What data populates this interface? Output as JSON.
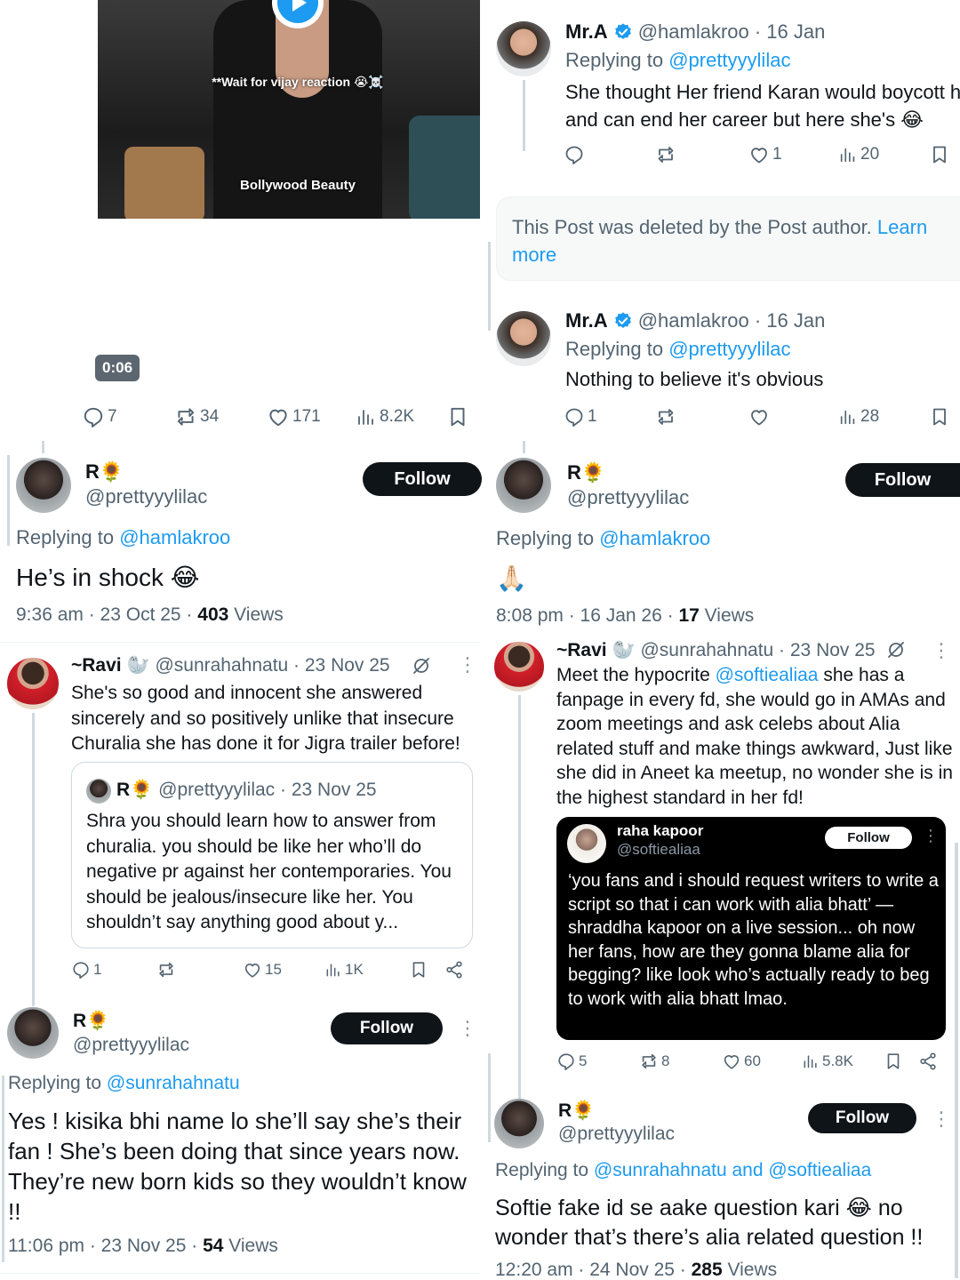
{
  "colors": {
    "accent": "#1d9bf0",
    "text": "#0f1419",
    "muted": "#536471",
    "dark_card": "#000000"
  },
  "left": {
    "video": {
      "overlay_text": "**Wait for vijay reaction 😭☠️",
      "caption": "Bollywood Beauty",
      "duration": "0:06",
      "play_icon": "play-icon"
    },
    "video_actions": {
      "replies": "7",
      "reposts": "34",
      "likes": "171",
      "views": "8.2K"
    },
    "reply1": {
      "name": "R🌻",
      "handle": "@prettyyylilac",
      "follow": "Follow",
      "replying_prefix": "Replying to ",
      "replying_to": "@hamlakroo",
      "text": "He’s in shock 😂",
      "time": "9:36 am · 23 Oct 25 · ",
      "views_count": "403",
      "views_label": " Views"
    },
    "ravi": {
      "name": "~Ravi 🦭",
      "handle": "@sunrahahnatu",
      "date": " · 23 Nov 25",
      "text": "She's so good and innocent she answered sincerely and so positively unlike that insecure Churalia she has done it for Jigra trailer before!",
      "quote": {
        "name": "R🌻",
        "handle": "@prettyyylilac",
        "date": " · 23 Nov 25",
        "text": "Shra you should learn how to answer from churalia. you should be like her who’ll do negative pr against her contemporaries. You should be jealous/insecure like her. You shouldn’t say anything good about y..."
      },
      "actions": {
        "replies": "1",
        "reposts": "",
        "likes": "15",
        "views": "1K"
      }
    },
    "reply2": {
      "name": "R🌻",
      "handle": "@prettyyylilac",
      "follow": "Follow",
      "replying_prefix": "Replying to ",
      "replying_to": "@sunrahahnatu",
      "text": "Yes ! kisika bhi name lo she’ll say she’s their fan ! She’s been doing that since years now. They’re new born kids so they wouldn’t know !!",
      "time": "11:06 pm · 23 Nov 25 · ",
      "views_count": "54",
      "views_label": " Views"
    }
  },
  "right": {
    "mra1": {
      "name": "Mr.A",
      "handle": "@hamlakroo",
      "date": " · 16 Jan",
      "replying_prefix": "Replying to ",
      "replying_to": "@prettyyylilac",
      "text": "She thought Her friend Karan would boycott her and can end her career but here she's 😂",
      "actions": {
        "replies": "",
        "reposts": "",
        "likes": "1",
        "views": "20"
      }
    },
    "deleted": {
      "text": "This Post was deleted by the Post author. ",
      "link": "Learn more"
    },
    "mra2": {
      "name": "Mr.A",
      "handle": "@hamlakroo",
      "date": " · 16 Jan",
      "replying_prefix": "Replying to ",
      "replying_to": "@prettyyylilac",
      "text": "Nothing to believe it's obvious",
      "actions": {
        "replies": "1",
        "reposts": "",
        "likes": "",
        "views": "28"
      }
    },
    "reply3": {
      "name": "R🌻",
      "handle": "@prettyyylilac",
      "follow": "Follow",
      "replying_prefix": "Replying to ",
      "replying_to": "@hamlakroo",
      "text": "🙏🏻",
      "time": "8:08 pm · 16 Jan 26 · ",
      "views_count": "17",
      "views_label": " Views"
    },
    "ravi": {
      "name": "~Ravi 🦭",
      "handle": "@sunrahahnatu",
      "date": " · 23 Nov 25",
      "text_pre": "Meet the hypocrite ",
      "mention": "@softiealiaa",
      "text_post": " she has a fanpage in every fd, she would go in AMAs and zoom meetings and ask celebs about Alia related stuff and make things awkward, Just like she did in Aneet ka meetup, no wonder she is in the highest standard in her fd!",
      "card": {
        "name": "raha kapoor",
        "handle": "@softiealiaa",
        "follow": "Follow",
        "text": "‘you fans and i should request writers to write a script so that i can work with alia bhatt’ — shraddha kapoor on a live session... oh now her fans, how are they gonna blame alia for begging? like look who’s actually ready to beg to work with alia bhatt lmao."
      },
      "actions": {
        "replies": "5",
        "reposts": "8",
        "likes": "60",
        "views": "5.8K"
      }
    },
    "reply4": {
      "name": "R🌻",
      "handle": "@prettyyylilac",
      "follow": "Follow",
      "replying_prefix": "Replying to ",
      "replying_to": "@sunrahahnatu and @softiealiaa",
      "text": "Softie fake id se aake question kari 😂 no wonder that’s there’s alia related question !!",
      "time": "12:20 am · 24 Nov 25 · ",
      "views_count": "285",
      "views_label": " Views"
    }
  }
}
